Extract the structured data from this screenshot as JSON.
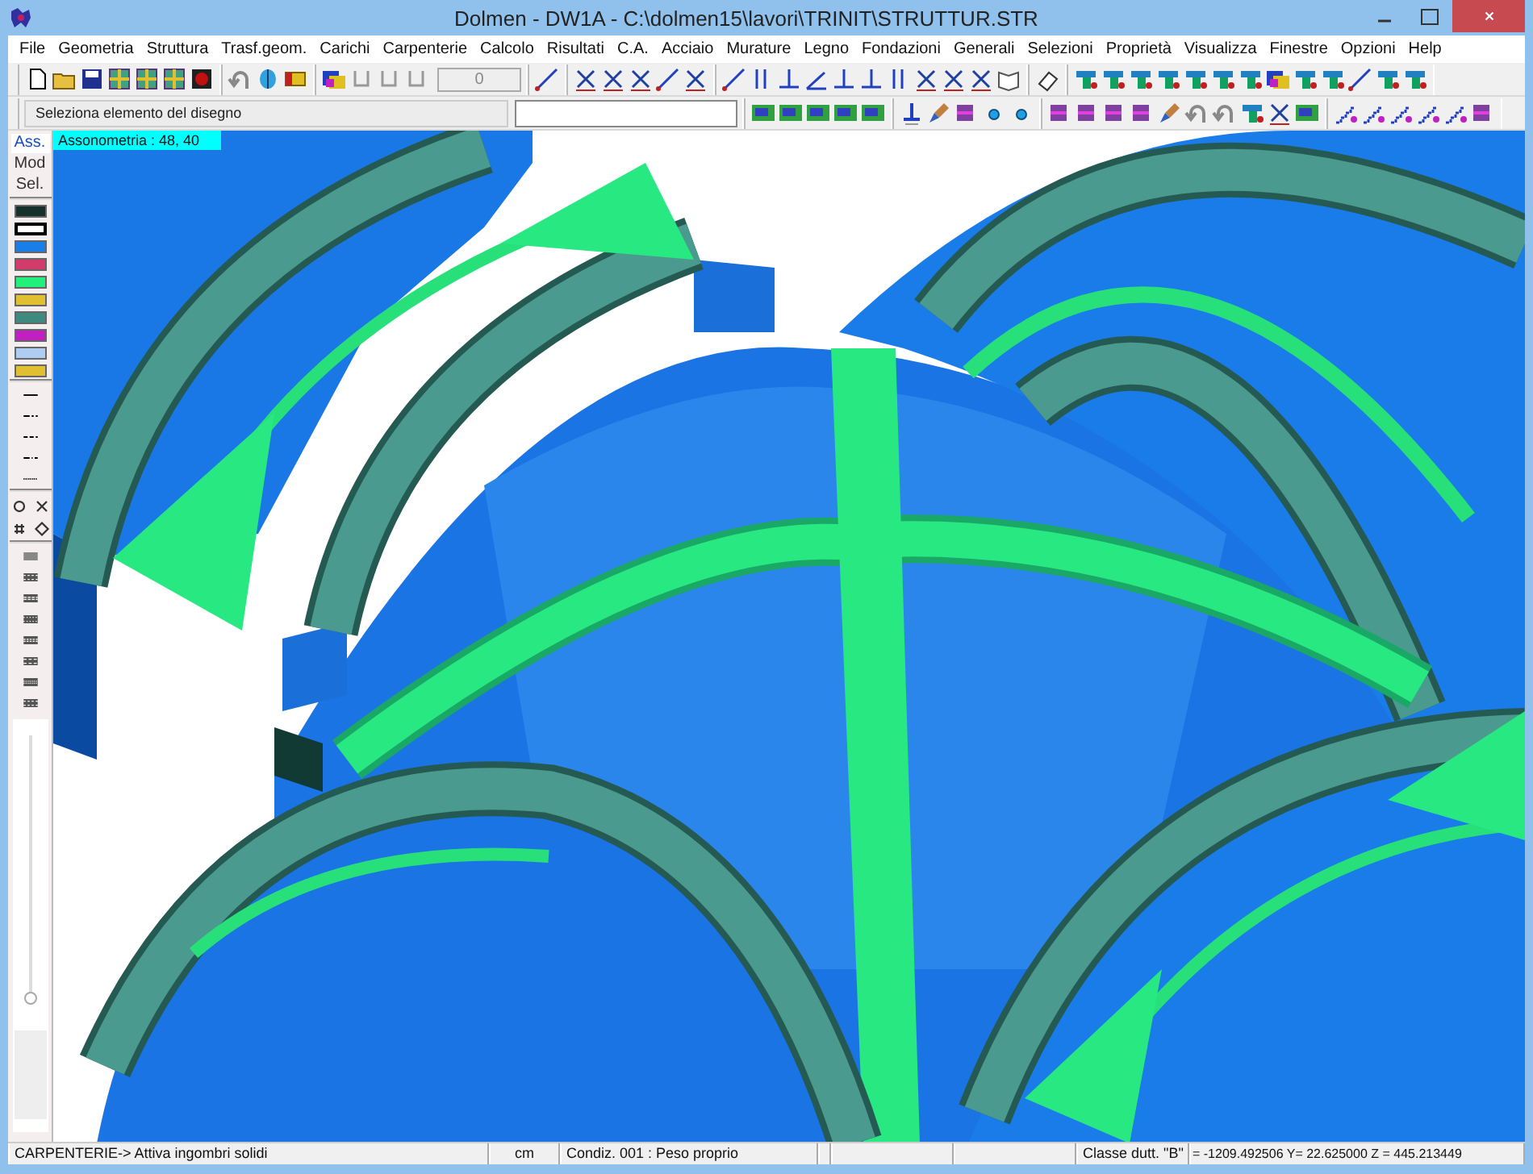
{
  "window": {
    "title": "Dolmen - DW1A - C:\\dolmen15\\lavori\\TRINIT\\STRUTTUR.STR"
  },
  "menu": [
    "File",
    "Geometria",
    "Struttura",
    "Trasf.geom.",
    "Carichi",
    "Carpenterie",
    "Calcolo",
    "Risultati",
    "C.A.",
    "Acciaio",
    "Murature",
    "Legno",
    "Fondazioni",
    "Generali",
    "Selezioni",
    "Proprietà",
    "Visualizza",
    "Finestre",
    "Opzioni",
    "Help"
  ],
  "toolbar": {
    "counter": "0",
    "prompt": "Seleziona  elemento del disegno"
  },
  "palette": {
    "tabs": [
      {
        "label": "Ass.",
        "selected": true
      },
      {
        "label": "Mod",
        "selected": false
      },
      {
        "label": "Sel.",
        "selected": false
      }
    ],
    "colors": [
      {
        "color": "#16302c",
        "selected": false
      },
      {
        "color": "#ffffff",
        "selected": true
      },
      {
        "color": "#1a7ee8",
        "selected": false
      },
      {
        "color": "#d23c6a",
        "selected": false
      },
      {
        "color": "#22f07a",
        "selected": false
      },
      {
        "color": "#e0c030",
        "selected": false
      },
      {
        "color": "#3f8a7e",
        "selected": false
      },
      {
        "color": "#c020c0",
        "selected": false
      },
      {
        "color": "#aecdf0",
        "selected": false
      },
      {
        "color": "#e0c030",
        "selected": false
      }
    ],
    "zoom_slider": {
      "level": 0
    }
  },
  "viewport": {
    "view_label": "Assonometria  :  48, 40"
  },
  "status_bar": [
    {
      "text": "CARPENTERIE-> Attiva ingombri solidi"
    },
    {
      "text": "cm"
    },
    {
      "text": "Condiz. 001 : Peso proprio"
    },
    {
      "text": "Classe dutt. \"B\""
    },
    {
      "text": "= -1209.492506 Y= 22.625000 Z = 445.213449"
    }
  ]
}
